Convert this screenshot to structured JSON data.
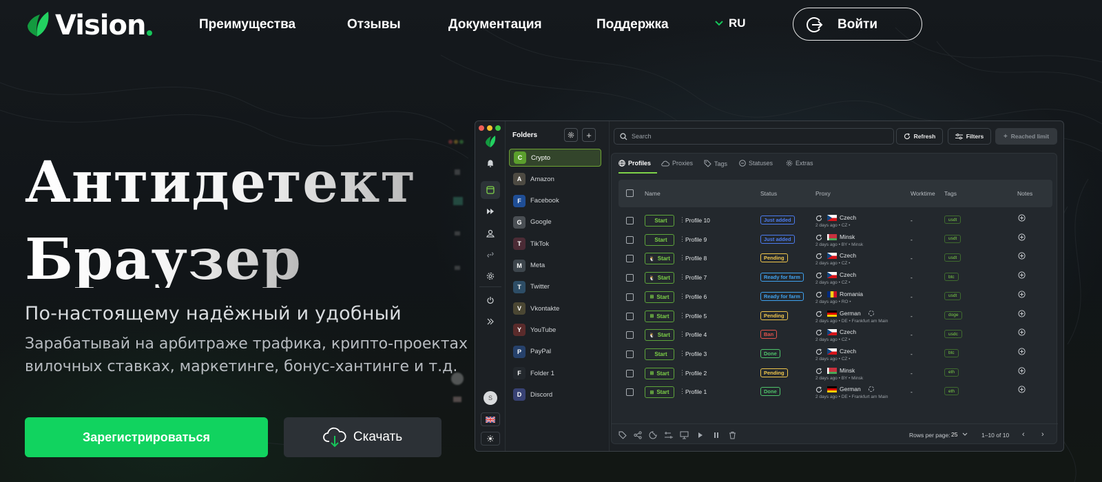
{
  "header": {
    "logo_text": "Vision",
    "nav": [
      "Преимущества",
      "Отзывы",
      "Документация",
      "Поддержка"
    ],
    "lang": "RU",
    "login_label": "Войти"
  },
  "hero": {
    "title_line1": "Антидетект",
    "title_line2": "Браузер",
    "subtitle": "По-настоящему надёжный и удобный",
    "desc_line1": "Зарабатывай на арбитраже трафика, крипто-проектах",
    "desc_line2": "вилочных ставках, маркетинге, бонус-хантинге и т.д.",
    "register_label": "Зарегистрироваться",
    "download_label": "Скачать"
  },
  "app": {
    "folders_title": "Folders",
    "folders": [
      {
        "label": "Crypto",
        "icon": "bitcoin-icon",
        "color": "#5b9f2d"
      },
      {
        "label": "Amazon",
        "icon": "amazon-icon",
        "color": "#4d4a42"
      },
      {
        "label": "Facebook",
        "icon": "facebook-icon",
        "color": "#1f4e96"
      },
      {
        "label": "Google",
        "icon": "google-icon",
        "color": "#4a4f54"
      },
      {
        "label": "TikTok",
        "icon": "tiktok-icon",
        "color": "#4b2b35"
      },
      {
        "label": "Meta",
        "icon": "meta-icon",
        "color": "#3e464d"
      },
      {
        "label": "Twitter",
        "icon": "twitter-icon",
        "color": "#2d4d66"
      },
      {
        "label": "Vkontakte",
        "icon": "vk-icon",
        "color": "#4b4733"
      },
      {
        "label": "YouTube",
        "icon": "youtube-icon",
        "color": "#5a2b2b"
      },
      {
        "label": "PayPal",
        "icon": "paypal-icon",
        "color": "#26416b"
      },
      {
        "label": "Folder 1",
        "icon": "folder-icon",
        "color": "#23282d"
      },
      {
        "label": "Discord",
        "icon": "discord-icon",
        "color": "#384274"
      }
    ],
    "search_placeholder": "Search",
    "refresh_label": "Refresh",
    "filters_label": "Filters",
    "reached_limit_label": "Reached limit",
    "tabs": [
      "Profiles",
      "Proxies",
      "Tags",
      "Statuses",
      "Extras"
    ],
    "columns": [
      "Name",
      "Status",
      "Proxy",
      "Worktime",
      "Tags",
      "Notes"
    ],
    "start_label": "Start",
    "rows": [
      {
        "os": "apple",
        "name": "Profile 10",
        "status": "Just added",
        "status_color": "#4c7cf0",
        "flag": "cz",
        "country": "Czech",
        "sub": "2 days ago • CZ •",
        "swap": false,
        "worktime": "-",
        "tag": "usdt"
      },
      {
        "os": "apple",
        "name": "Profile 9",
        "status": "Just added",
        "status_color": "#4c7cf0",
        "flag": "by",
        "country": "Minsk",
        "sub": "2 days ago • BY • Minsk",
        "swap": false,
        "worktime": "-",
        "tag": "usdt"
      },
      {
        "os": "linux",
        "name": "Profile 8",
        "status": "Pending",
        "status_color": "#f0c64c",
        "flag": "cz",
        "country": "Czech",
        "sub": "2 days ago • CZ •",
        "swap": false,
        "worktime": "-",
        "tag": "usdt"
      },
      {
        "os": "linux",
        "name": "Profile 7",
        "status": "Ready for farm",
        "status_color": "#3fa2f0",
        "flag": "cz",
        "country": "Czech",
        "sub": "2 days ago • CZ •",
        "swap": false,
        "worktime": "-",
        "tag": "btc"
      },
      {
        "os": "windows",
        "name": "Profile 6",
        "status": "Ready for farm",
        "status_color": "#3fa2f0",
        "flag": "ro",
        "country": "Romania",
        "sub": "2 days ago • RO •",
        "swap": false,
        "worktime": "-",
        "tag": "usdt"
      },
      {
        "os": "windows",
        "name": "Profile 5",
        "status": "Pending",
        "status_color": "#f0c64c",
        "flag": "de",
        "country": "German",
        "sub": "2 days ago • DE • Frankfurt am Main",
        "swap": true,
        "worktime": "-",
        "tag": "doge"
      },
      {
        "os": "linux",
        "name": "Profile 4",
        "status": "Ban",
        "status_color": "#e5534b",
        "flag": "cz",
        "country": "Czech",
        "sub": "2 days ago • CZ •",
        "swap": false,
        "worktime": "-",
        "tag": "usdc"
      },
      {
        "os": "apple",
        "name": "Profile 3",
        "status": "Done",
        "status_color": "#4fc46b",
        "flag": "cz",
        "country": "Czech",
        "sub": "2 days ago • CZ •",
        "swap": false,
        "worktime": "-",
        "tag": "btc"
      },
      {
        "os": "windows",
        "name": "Profile 2",
        "status": "Pending",
        "status_color": "#f0c64c",
        "flag": "by",
        "country": "Minsk",
        "sub": "2 days ago • BY • Minsk",
        "swap": false,
        "worktime": "-",
        "tag": "eth"
      },
      {
        "os": "windows",
        "name": "Profile 1",
        "status": "Done",
        "status_color": "#4fc46b",
        "flag": "de",
        "country": "German",
        "sub": "2 days ago • DE • Frankfurt am Main",
        "swap": true,
        "worktime": "-",
        "tag": "eth"
      }
    ],
    "rows_per_page_label": "Rows per page:",
    "rows_per_page_value": "25",
    "range_label": "1–10 of 10",
    "avatar_letter": "S",
    "accent_color": "#7ed348"
  },
  "colors": {
    "brand_green": "#11d35f",
    "background": "#14181b"
  }
}
